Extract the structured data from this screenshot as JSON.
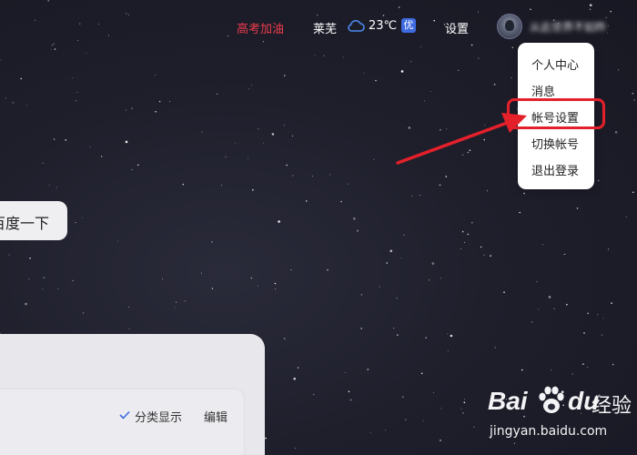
{
  "topbar": {
    "promo_label": "高考加油",
    "city": "莱芜",
    "temperature": "23℃",
    "air_quality": "优",
    "settings_label": "设置",
    "username": "从此世界不如昨",
    "colors": {
      "promo": "#ef3a4c",
      "badge": "#3e6be0"
    },
    "icons": {
      "weather": "cloud-icon"
    }
  },
  "user_menu": {
    "items": [
      {
        "label": "个人中心"
      },
      {
        "label": "消息"
      },
      {
        "label": "帐号设置"
      },
      {
        "label": "切换帐号"
      },
      {
        "label": "退出登录"
      }
    ],
    "highlight_color": "#e4202a"
  },
  "search": {
    "button_label": "百度一下"
  },
  "panel": {
    "category_label": "分类显示",
    "category_checked": true,
    "edit_label": "编辑"
  },
  "watermark": {
    "brand_left": "Bai",
    "brand_right": "du",
    "brand_cn": "经验",
    "url": "jingyan.baidu.com"
  }
}
